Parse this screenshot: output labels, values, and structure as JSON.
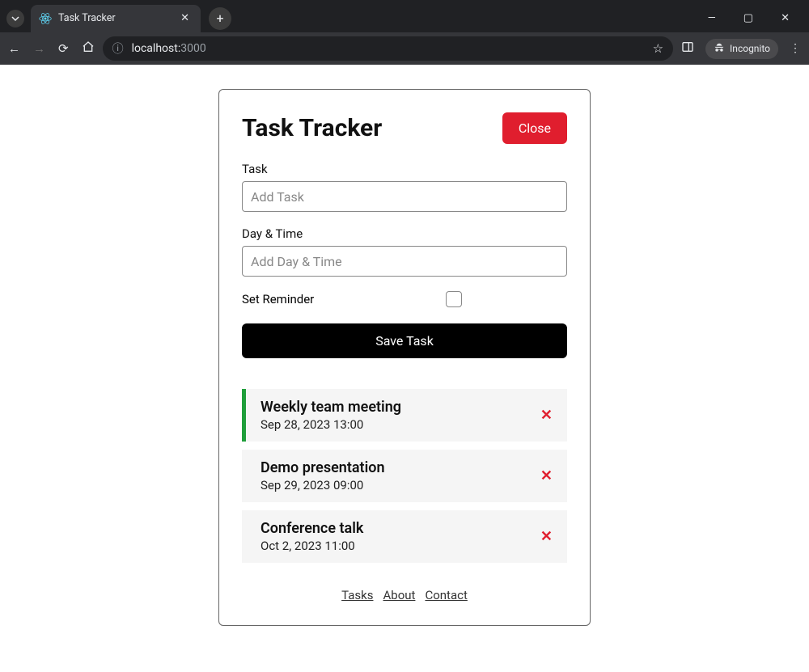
{
  "browser": {
    "tabTitle": "Task Tracker",
    "url_host": "localhost:",
    "url_port": "3000",
    "incognitoLabel": "Incognito"
  },
  "app": {
    "title": "Task Tracker",
    "toggleButton": "Close",
    "form": {
      "taskLabel": "Task",
      "taskPlaceholder": "Add Task",
      "dayLabel": "Day & Time",
      "dayPlaceholder": "Add Day & Time",
      "reminderLabel": "Set Reminder",
      "submitLabel": "Save Task"
    },
    "tasks": [
      {
        "text": "Weekly team meeting",
        "day": "Sep 28, 2023 13:00",
        "reminder": true
      },
      {
        "text": "Demo presentation",
        "day": "Sep 29, 2023 09:00",
        "reminder": false
      },
      {
        "text": "Conference talk",
        "day": "Oct 2, 2023 11:00",
        "reminder": false
      }
    ],
    "footerLinks": [
      "Tasks",
      "About",
      "Contact"
    ]
  }
}
